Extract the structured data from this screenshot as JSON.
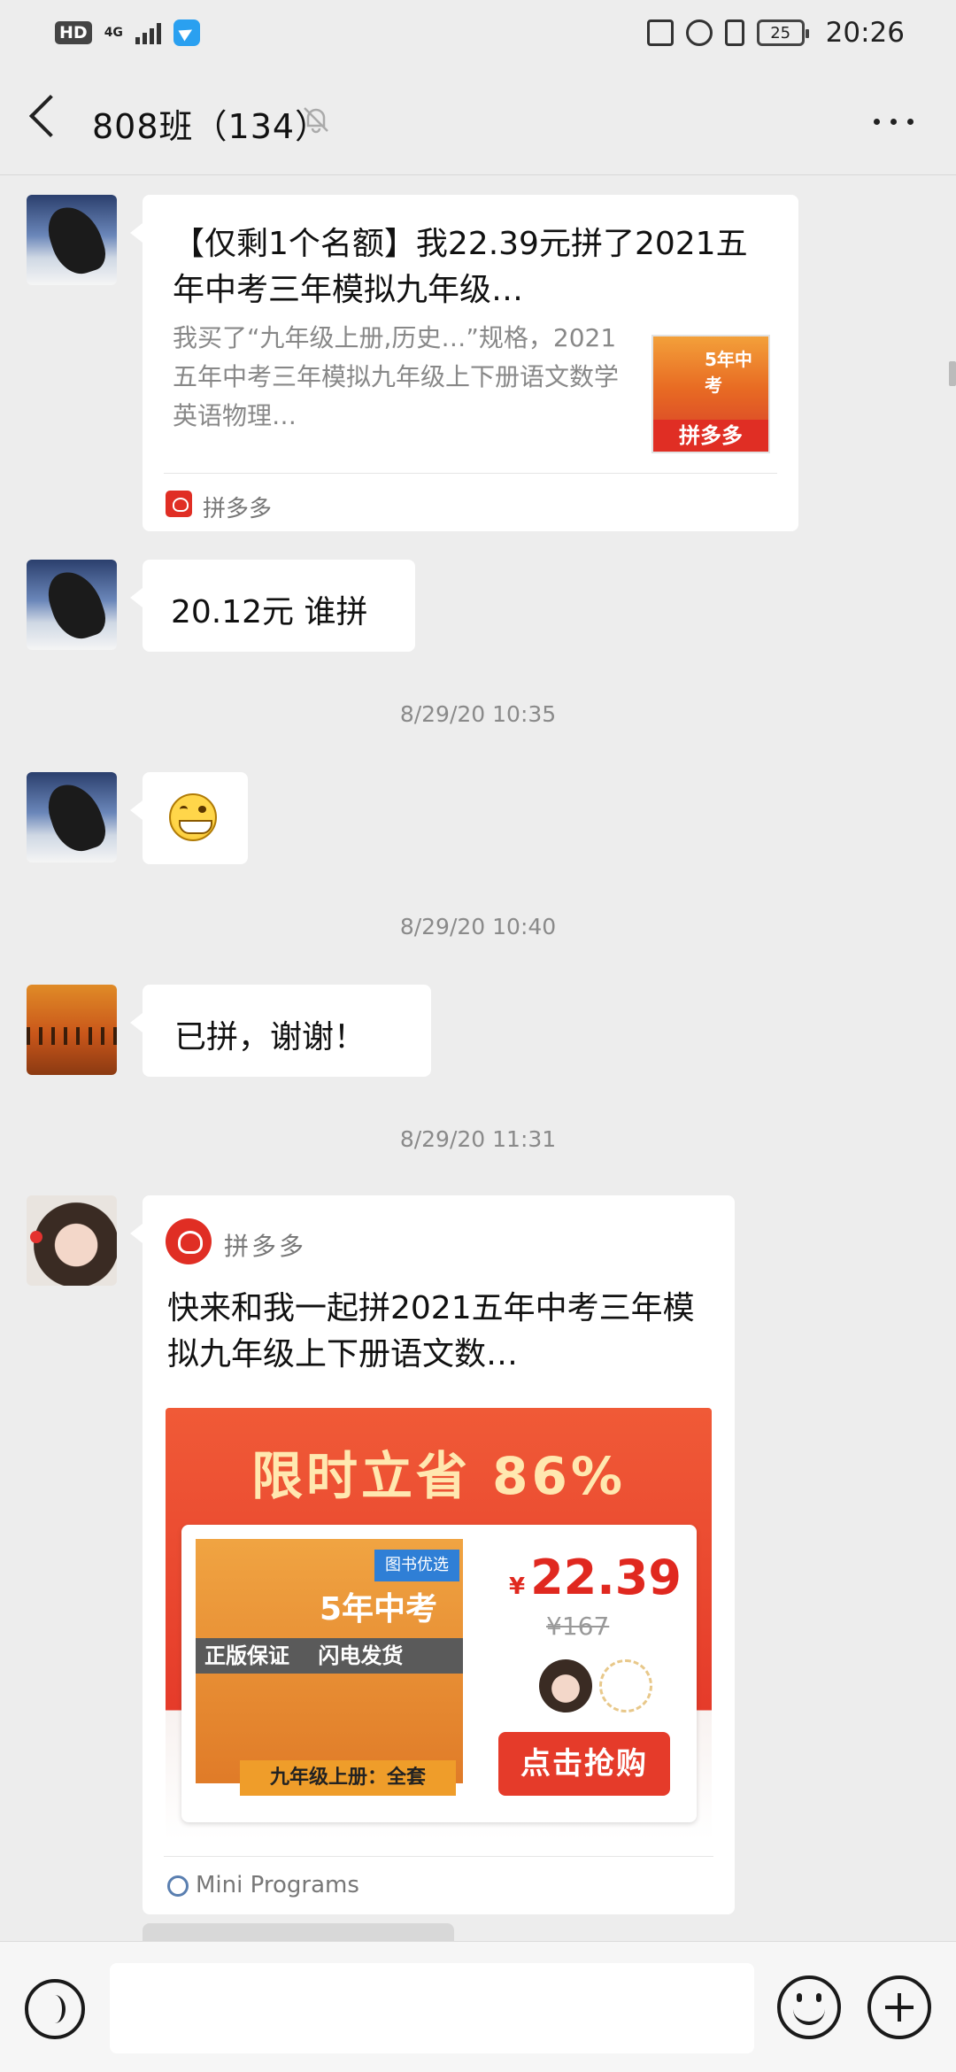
{
  "status_bar": {
    "hd": "HD",
    "network": "4G",
    "battery": "25",
    "time": "20:26"
  },
  "nav": {
    "title": "808班（134）"
  },
  "messages": [
    {
      "card_title": "【仅剩1个名额】我22.39元拼了2021五年中考三年模拟九年级…",
      "card_desc": "我买了“九年级上册,历史…”规格，2021五年中考三年模拟九年级上下册语文数学英语物理…",
      "thumb_text": "5年中考",
      "thumb_brand": "拼多多",
      "source": "拼多多"
    },
    {
      "text": "20.12元 谁拼"
    },
    {
      "timestamp": "8/29/20 10:35"
    },
    {
      "emoji": "grinning-face"
    },
    {
      "timestamp": "8/29/20 10:40"
    },
    {
      "text": "已拼，谢谢！"
    },
    {
      "timestamp": "8/29/20 11:31"
    },
    {
      "mp_source": "拼多多",
      "mp_title": "快来和我一起拼2021五年中考三年模拟九年级上下册语文数…",
      "headline": "限时立省 86%",
      "book_title": "5年中考",
      "book_tag": "图书优选",
      "book_features": "正版保证 闪电发货",
      "book_bar": "九年级上册：全套",
      "price": "22.39",
      "currency": "¥",
      "orig_price": "¥167",
      "buy_label": "点击抢购",
      "footer": "Mini Programs"
    }
  ],
  "input": {
    "placeholder": ""
  },
  "colors": {
    "accent_red": "#e02e24",
    "background": "#ededed"
  }
}
